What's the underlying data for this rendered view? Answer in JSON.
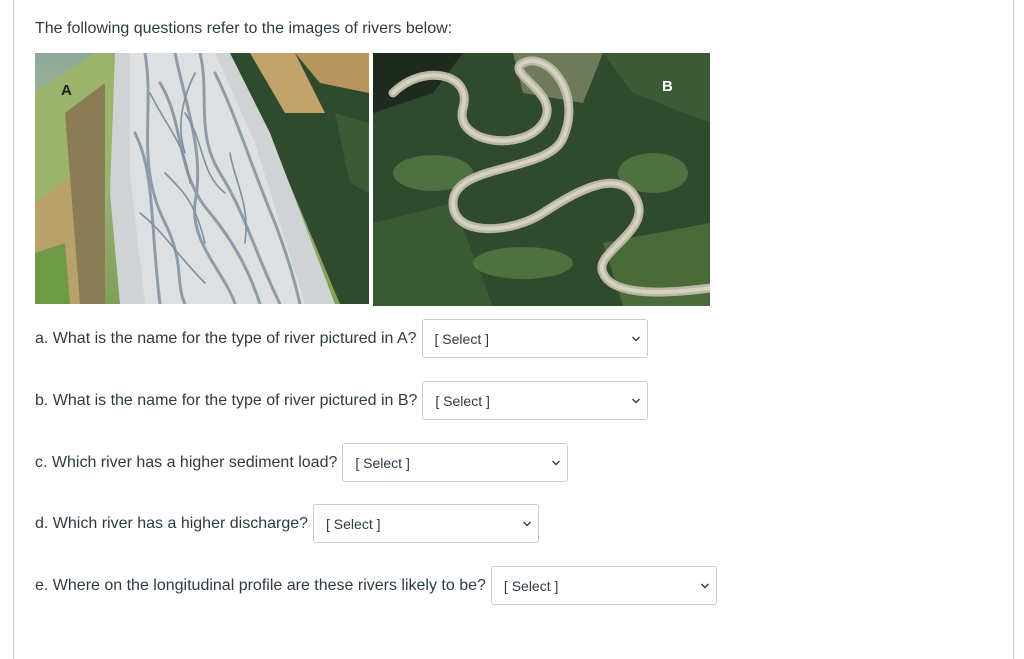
{
  "intro": "The following questions refer to the images of rivers below:",
  "images": {
    "a_label": "A",
    "b_label": "B"
  },
  "questions": [
    {
      "text": "a. What is the name for the type of river pictured in A?",
      "selected": "[ Select ]"
    },
    {
      "text": "b. What is the name for the type of river pictured in B?",
      "selected": "[ Select ]"
    },
    {
      "text": "c. Which river has a higher sediment load?",
      "selected": "[ Select ]"
    },
    {
      "text": "d. Which river has a higher discharge?",
      "selected": "[ Select ]"
    },
    {
      "text": "e. Where on the longitudinal profile are these rivers likely to be?",
      "selected": "[ Select ]"
    }
  ],
  "icons": {
    "dropdown": "chevron-down-icon"
  },
  "colors": {
    "text": "#2d3b45",
    "border": "#c7cdd1",
    "forest": "#2f4a2c",
    "gravel": "#cfd3d4",
    "river": "#9aa9b6"
  }
}
